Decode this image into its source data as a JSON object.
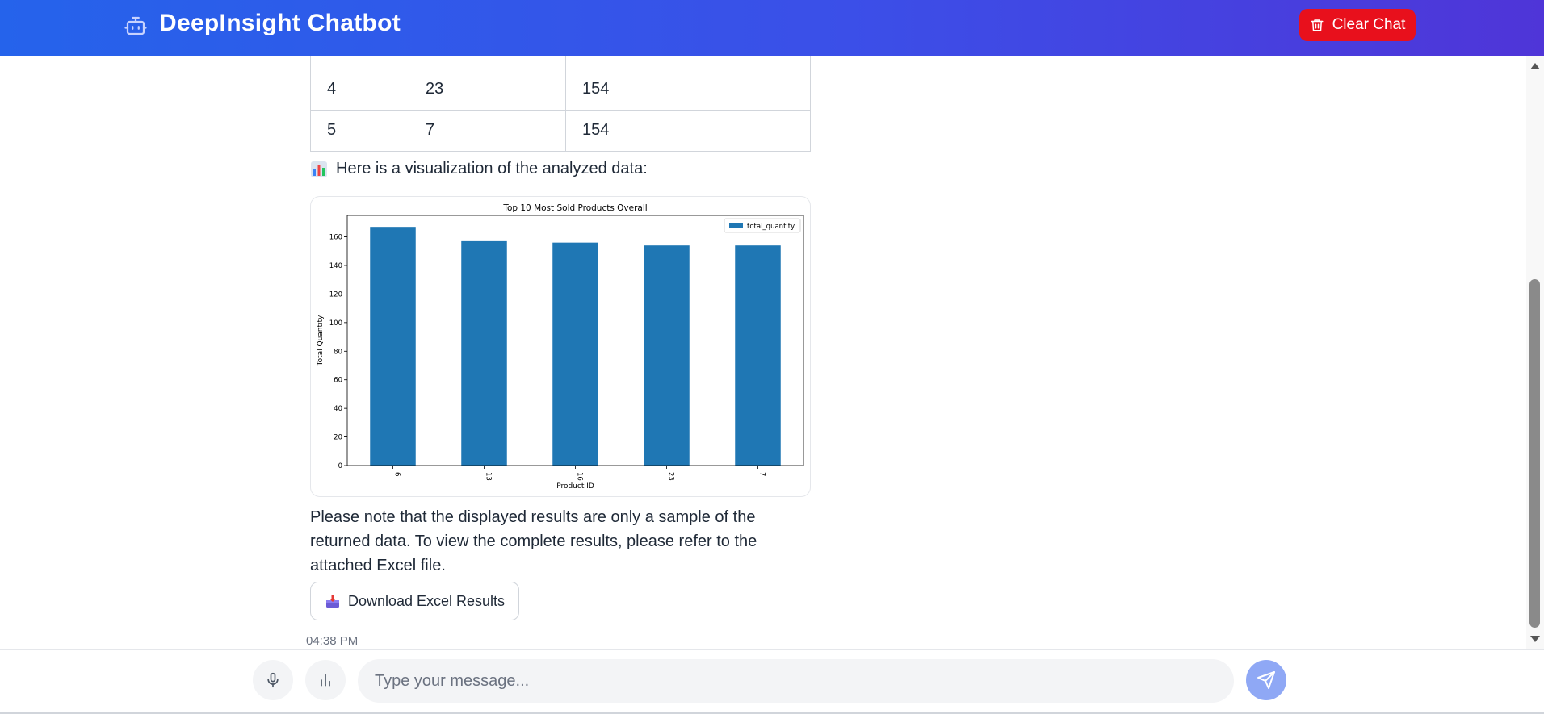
{
  "header": {
    "title": "DeepInsight Chatbot",
    "bot_icon": "robot-icon",
    "clear_label": "Clear Chat",
    "clear_icon": "trash-icon",
    "clear_color": "#e8101c"
  },
  "results_table": {
    "rows": [
      [
        "",
        "",
        ""
      ],
      [
        "4",
        "23",
        "154"
      ],
      [
        "5",
        "7",
        "154"
      ]
    ]
  },
  "visualization_intro": {
    "icon": "bar-chart-emoji-icon",
    "text": "Here is a visualization of the analyzed data:"
  },
  "chart_data": {
    "type": "bar",
    "title": "Top 10 Most Sold Products Overall",
    "xlabel": "Product ID",
    "ylabel": "Total Quantity",
    "categories": [
      "6",
      "13",
      "16",
      "23",
      "7"
    ],
    "series": [
      {
        "name": "total_quantity",
        "values": [
          167,
          157,
          156,
          154,
          154
        ],
        "color": "#1f77b4"
      }
    ],
    "ylim": [
      0,
      175
    ],
    "yticks": [
      0,
      20,
      40,
      60,
      80,
      100,
      120,
      140,
      160
    ],
    "legend": "top-right",
    "grid": false
  },
  "note": {
    "text": "Please note that the displayed results are only a sample of the returned data. To view the complete results, please refer to the attached Excel file."
  },
  "download": {
    "icon": "inbox-tray-icon",
    "label": "Download Excel Results"
  },
  "message_time": "04:38 PM",
  "composer": {
    "placeholder": "Type your message...",
    "mic_icon": "microphone-icon",
    "chart_icon": "bar-chart-icon",
    "send_icon": "send-icon",
    "send_color": "#8fa8f5"
  }
}
